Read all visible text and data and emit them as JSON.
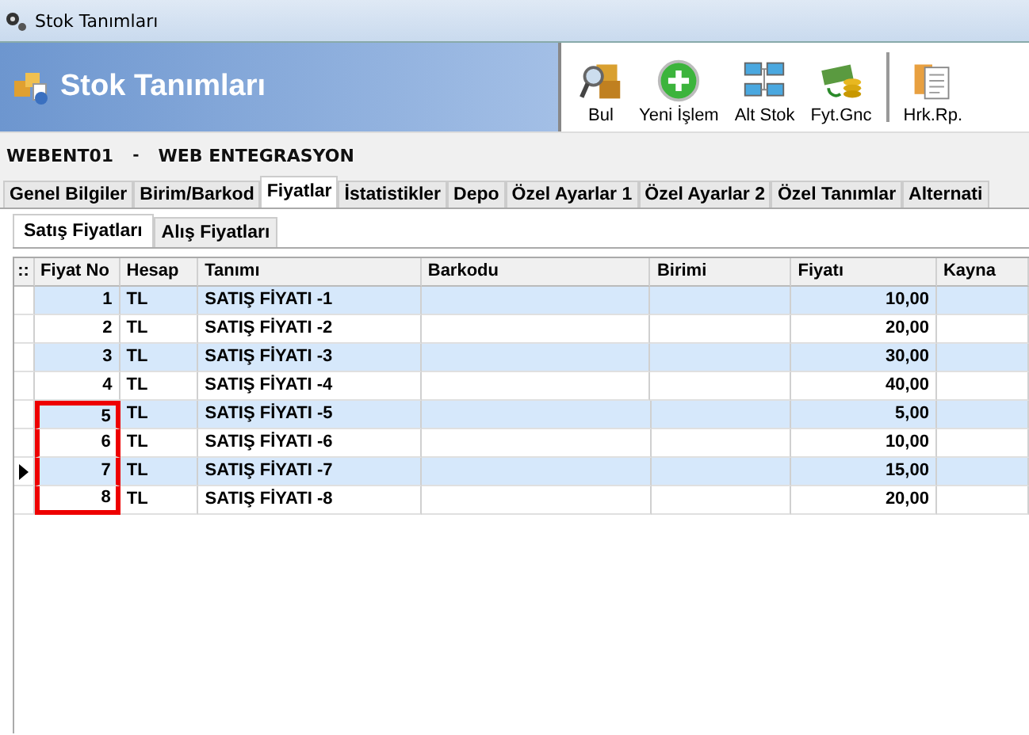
{
  "window": {
    "title": "Stok Tanımları"
  },
  "header": {
    "title": "Stok Tanımları"
  },
  "toolbar": [
    {
      "label": "Bul",
      "kind": "find"
    },
    {
      "label": "Yeni İşlem",
      "kind": "add"
    },
    {
      "label": "Alt Stok",
      "kind": "network"
    },
    {
      "label": "Fyt.Gnc",
      "kind": "money"
    },
    {
      "label": "Hrk.Rp.",
      "kind": "report"
    }
  ],
  "record": {
    "code": "WEBENT01",
    "separator": "-",
    "name": "WEB ENTEGRASYON"
  },
  "tabs": [
    {
      "label": "Genel Bilgiler",
      "selected": false
    },
    {
      "label": "Birim/Barkod",
      "selected": false
    },
    {
      "label": "Fiyatlar",
      "selected": true
    },
    {
      "label": "İstatistikler",
      "selected": false
    },
    {
      "label": "Depo",
      "selected": false
    },
    {
      "label": "Özel Ayarlar 1",
      "selected": false
    },
    {
      "label": "Özel Ayarlar 2",
      "selected": false
    },
    {
      "label": "Özel Tanımlar",
      "selected": false
    },
    {
      "label": "Alternati",
      "selected": false
    }
  ],
  "subtabs": [
    {
      "label": "Satış Fiyatları",
      "selected": true
    },
    {
      "label": "Alış Fiyatları",
      "selected": false
    }
  ],
  "table": {
    "corner": "::",
    "columns": [
      "Fiyat No",
      "Hesap",
      "Tanımı",
      "Barkodu",
      "Birimi",
      "Fiyatı",
      "Kayna"
    ],
    "rows": [
      {
        "no": "1",
        "hesap": "TL",
        "tanimi": "SATIŞ FİYATI -1",
        "fiyati": "10,00",
        "selected": false,
        "marked": false
      },
      {
        "no": "2",
        "hesap": "TL",
        "tanimi": "SATIŞ FİYATI -2",
        "fiyati": "20,00",
        "selected": false,
        "marked": false
      },
      {
        "no": "3",
        "hesap": "TL",
        "tanimi": "SATIŞ FİYATI -3",
        "fiyati": "30,00",
        "selected": false,
        "marked": false
      },
      {
        "no": "4",
        "hesap": "TL",
        "tanimi": "SATIŞ FİYATI -4",
        "fiyati": "40,00",
        "selected": false,
        "marked": false
      },
      {
        "no": "5",
        "hesap": "TL",
        "tanimi": "SATIŞ FİYATI -5",
        "fiyati": "5,00",
        "selected": false,
        "marked": true
      },
      {
        "no": "6",
        "hesap": "TL",
        "tanimi": "SATIŞ FİYATI -6",
        "fiyati": "10,00",
        "selected": false,
        "marked": true
      },
      {
        "no": "7",
        "hesap": "TL",
        "tanimi": "SATIŞ FİYATI -7",
        "fiyati": "15,00",
        "selected": true,
        "marked": true
      },
      {
        "no": "8",
        "hesap": "TL",
        "tanimi": "SATIŞ FİYATI -8",
        "fiyati": "20,00",
        "selected": false,
        "marked": true
      }
    ]
  }
}
